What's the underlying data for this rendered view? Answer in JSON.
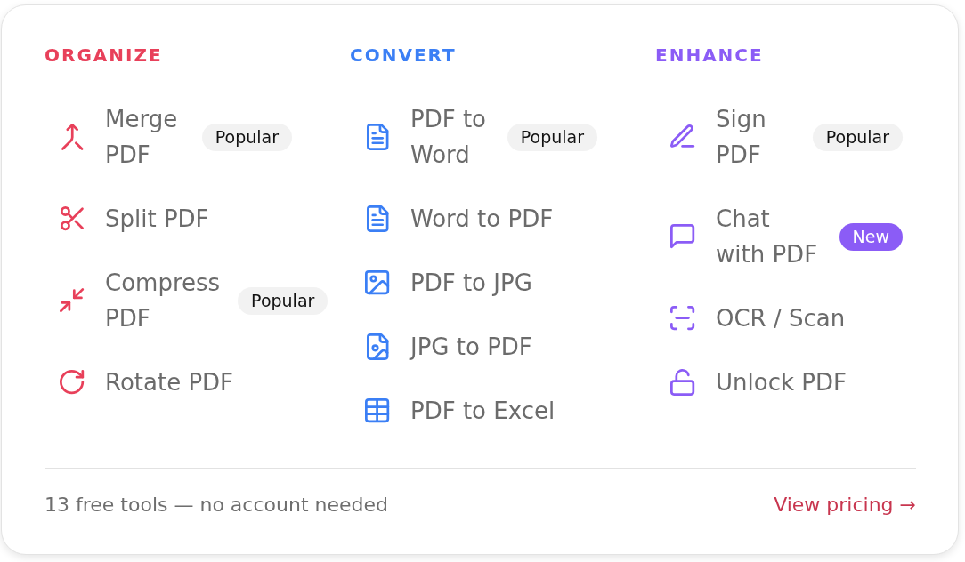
{
  "sections": [
    {
      "title": "ORGANIZE",
      "color": "#e8405a",
      "items": [
        {
          "label": "Merge PDF",
          "badge": {
            "text": "Popular",
            "kind": "plain"
          }
        },
        {
          "label": "Split PDF"
        },
        {
          "label": "Compress PDF",
          "badge": {
            "text": "Popular",
            "kind": "plain"
          }
        },
        {
          "label": "Rotate PDF"
        }
      ]
    },
    {
      "title": "CONVERT",
      "color": "#3b7ff5",
      "items": [
        {
          "label": "PDF to Word",
          "badge": {
            "text": "Popular",
            "kind": "plain"
          }
        },
        {
          "label": "Word to PDF"
        },
        {
          "label": "PDF to JPG"
        },
        {
          "label": "JPG to PDF"
        },
        {
          "label": "PDF to Excel"
        }
      ]
    },
    {
      "title": "ENHANCE",
      "color": "#8b5cf6",
      "items": [
        {
          "label": "Sign PDF",
          "badge": {
            "text": "Popular",
            "kind": "plain"
          }
        },
        {
          "label": "Chat with PDF",
          "badge": {
            "text": "New",
            "kind": "filled"
          }
        },
        {
          "label": "OCR / Scan"
        },
        {
          "label": "Unlock PDF"
        }
      ]
    }
  ],
  "footer": {
    "note": "13 free tools — no account needed",
    "link": "View pricing →"
  }
}
